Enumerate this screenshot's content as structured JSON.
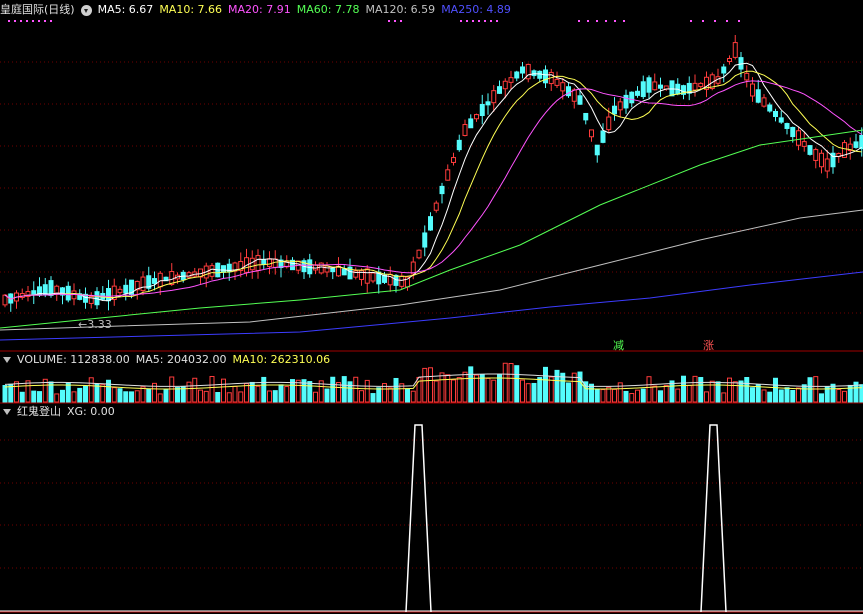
{
  "main_header": {
    "stock_title": "皇庭国际(日线)",
    "ma5": "MA5: 6.67",
    "ma10": "MA10: 7.66",
    "ma20": "MA20: 7.91",
    "ma60": "MA60: 7.78",
    "ma120": "MA120: 6.59",
    "ma250": "MA250: 4.89"
  },
  "main_chart": {
    "low_marker_label": "3.33",
    "signal_labels": [
      "减",
      "涨"
    ]
  },
  "volume_header": {
    "title": "VOLUME: 112838.00",
    "ma5": "MA5: 204032.00",
    "ma10": "MA10: 262310.06"
  },
  "indicator_header": {
    "title": "红鬼登山",
    "xg": "XG: 0.00"
  },
  "colors": {
    "up": "#ff3c3c",
    "down": "#54fcfc",
    "ma5": "#ffffff",
    "ma10": "#ffff54",
    "ma20": "#ff54ff",
    "ma60": "#54ff54",
    "ma120": "#c0c0c0",
    "ma250": "#3c3cff",
    "divider": "#a00000"
  }
}
